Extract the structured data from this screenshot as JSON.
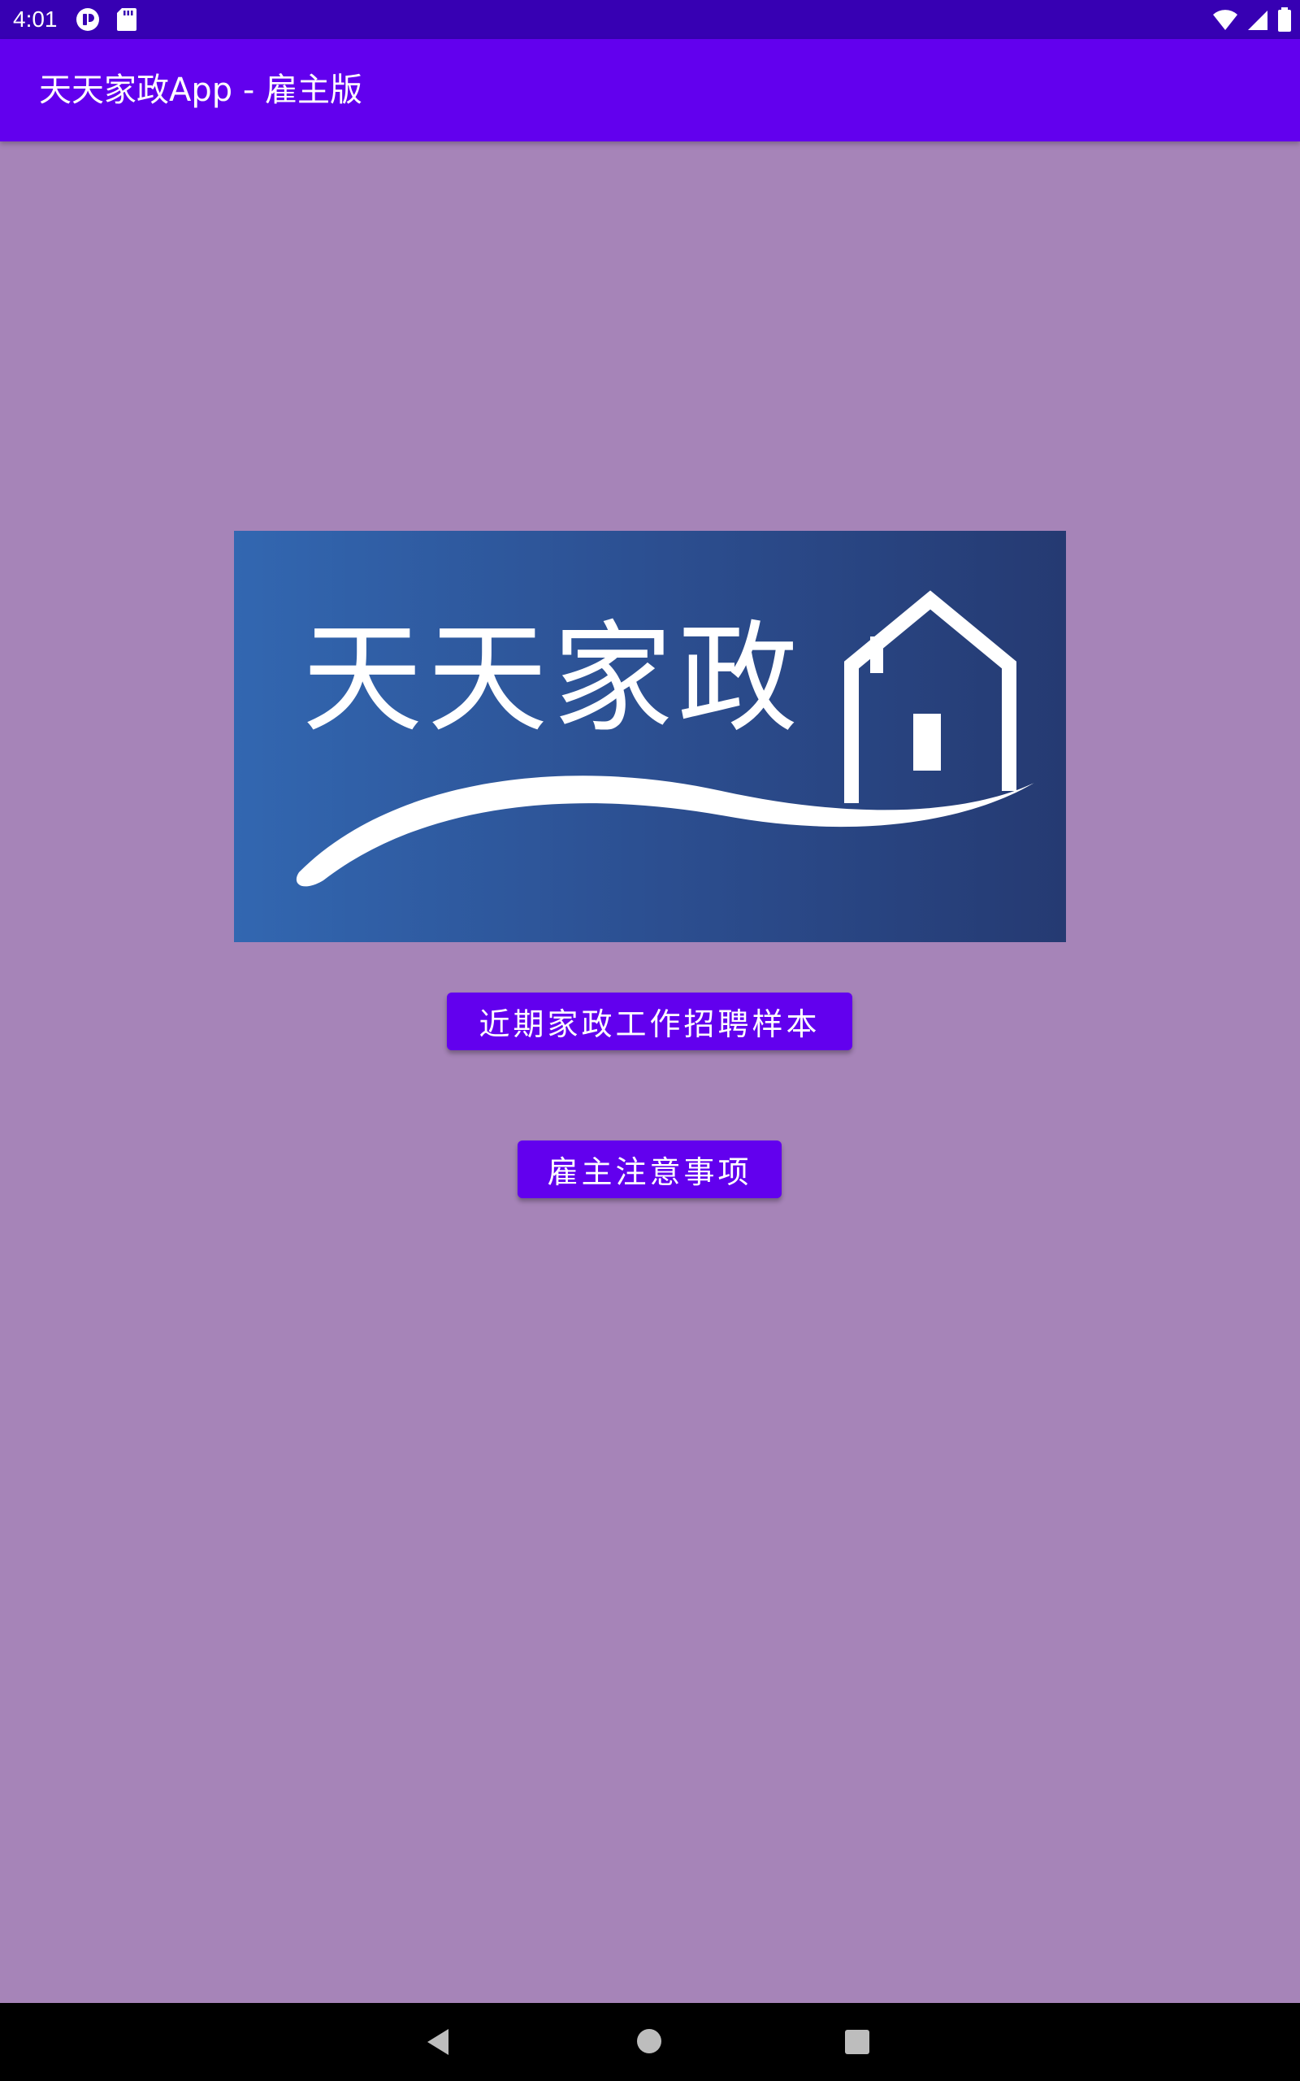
{
  "status_bar": {
    "time": "4:01",
    "left_icons": [
      "pocket-icon",
      "sd-card-icon"
    ],
    "right_icons": [
      "wifi-icon",
      "cell-signal-icon",
      "battery-icon"
    ]
  },
  "app_bar": {
    "title": "天天家政App - 雇主版",
    "color": "#6200ee"
  },
  "logo": {
    "text": "天天家政",
    "icon": "house-icon"
  },
  "buttons": {
    "samples_label": "近期家政工作招聘样本",
    "notes_label": "雇主注意事项"
  },
  "nav_bar": {
    "icons": [
      "back-icon",
      "home-icon",
      "recents-icon"
    ]
  },
  "colors": {
    "background": "#a684b8",
    "status_bar": "#3700b3",
    "accent": "#6200ee"
  }
}
